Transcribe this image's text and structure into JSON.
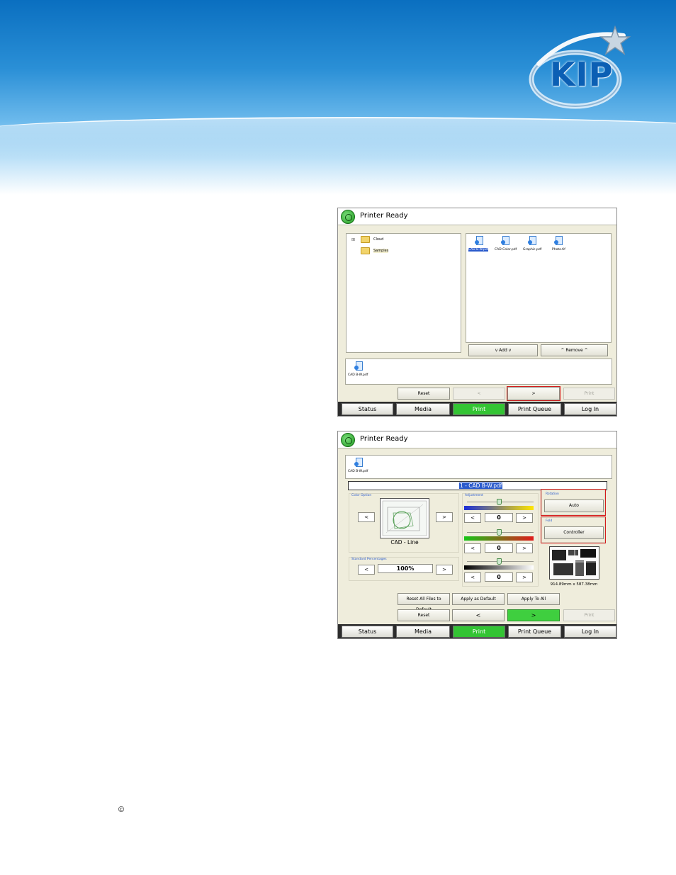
{
  "brand": {
    "logo_text": "KIP",
    "accent": "#0b5fb4"
  },
  "screen1": {
    "title": "Printer Ready",
    "tree": [
      {
        "label": "Cloud",
        "expander": "⊞"
      },
      {
        "label": "Samples",
        "expander": ""
      }
    ],
    "files": [
      {
        "label": "CAD B-W.pdf",
        "selected": true
      },
      {
        "label": "CAD Color.pdf",
        "selected": false
      },
      {
        "label": "Graphic.pdf",
        "selected": false
      },
      {
        "label": "Photo.tif",
        "selected": false
      }
    ],
    "add_label": "v Add v",
    "remove_label": "^ Remove ^",
    "queued_file": "CAD B-W.pdf",
    "reset_label": "Reset",
    "prev_label": "<",
    "next_label": ">",
    "print_label": "Print"
  },
  "screen2": {
    "title": "Printer Ready",
    "queued_file": "CAD B-W.pdf",
    "file_header": "1 - CAD B-W.pdf",
    "color_option": {
      "label": "Color Option",
      "prev": "<",
      "next": ">",
      "mode": "CAD - Line"
    },
    "standard_percentages": {
      "label": "Standard Percentages",
      "prev": "<",
      "next": ">",
      "value": "100%"
    },
    "adjustment": {
      "label": "Adjustment",
      "rows": [
        {
          "value": "0",
          "dec": "<",
          "inc": ">",
          "gradient": "linear-gradient(90deg,#1b2ed8,#ffe600)"
        },
        {
          "value": "0",
          "dec": "<",
          "inc": ">",
          "gradient": "linear-gradient(90deg,#17c517,#e01b1b)"
        },
        {
          "value": "0",
          "dec": "<",
          "inc": ">",
          "gradient": "linear-gradient(90deg,#000000,#ffffff)"
        }
      ]
    },
    "rotation": {
      "label": "Rotation",
      "value": "Auto"
    },
    "fold": {
      "label": "Fold",
      "value": "Controller"
    },
    "size_text": "914.89mm x 587.38mm",
    "reset_all_label": "Reset All Files to Default",
    "apply_default_label": "Apply as Default",
    "apply_all_label": "Apply To All",
    "reset_label": "Reset",
    "prev_label": "<",
    "next_label": ">",
    "print_label": "Print"
  },
  "tabs": [
    {
      "label": "Status",
      "active": false
    },
    {
      "label": "Media",
      "active": false
    },
    {
      "label": "Print",
      "active": true
    },
    {
      "label": "Print Queue",
      "active": false
    },
    {
      "label": "Log In",
      "active": false
    }
  ],
  "footer": {
    "copyright_symbol": "©"
  }
}
